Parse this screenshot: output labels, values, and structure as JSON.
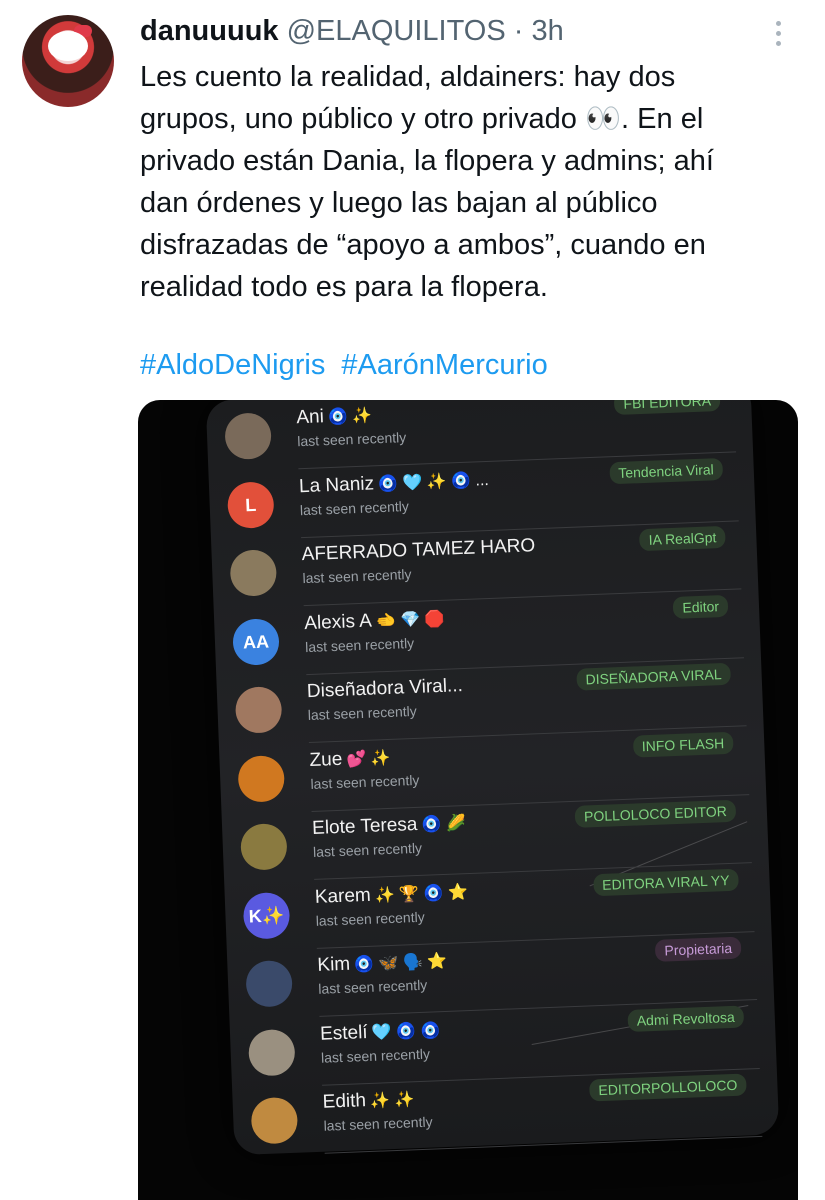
{
  "tweet": {
    "name": "danuuuuk",
    "handle": "@ELAQUILITOS",
    "separator": "·",
    "time": "3h",
    "lines": [
      "Les cuento la realidad, aldainers: hay dos",
      "grupos, uno público y otro privado 👀. En el",
      "privado están Dania, la flopera y admins; ahí",
      "dan órdenes y luego las bajan al público",
      "disfrazadas de “apoyo a ambos”, cuando en",
      "realidad todo es para la flopera."
    ],
    "hashtags": [
      "#AldoDeNigris",
      "#AarónMercurio"
    ]
  },
  "photo": {
    "members": [
      {
        "name": "Ani",
        "emoji": "🧿 ✨",
        "status": "last seen recently",
        "role": "FBI EDITORA",
        "avatar_letter": "",
        "avatar_color": "#7a6a5a"
      },
      {
        "name": "La Naniz",
        "emoji": "🧿 🩵 ✨ 🧿 ...",
        "status": "last seen recently",
        "role": "Tendencia Viral",
        "avatar_letter": "L",
        "avatar_color": "#e2503a"
      },
      {
        "name": "AFERRADO TAMEZ HARO",
        "emoji": "",
        "status": "last seen recently",
        "role": "IA RealGpt",
        "avatar_letter": "",
        "avatar_color": "#8a7a5e"
      },
      {
        "name": "Alexis A",
        "emoji": "🫲 💎 🛑",
        "status": "last seen recently",
        "role": "Editor",
        "avatar_letter": "AA",
        "avatar_color": "#3a82e0"
      },
      {
        "name": "Diseñadora Viral...",
        "emoji": "",
        "status": "last seen recently",
        "role": "DISEÑADORA VIRAL",
        "avatar_letter": "",
        "avatar_color": "#a07860"
      },
      {
        "name": "Zue",
        "emoji": "💕 ✨",
        "status": "last seen recently",
        "role": "INFO FLASH",
        "avatar_letter": "",
        "avatar_color": "#d07820"
      },
      {
        "name": "Elote Teresa",
        "emoji": "🧿 🌽",
        "status": "last seen recently",
        "role": "POLLOLOCO EDITOR",
        "avatar_letter": "",
        "avatar_color": "#8a7a40"
      },
      {
        "name": "Karem",
        "emoji": "✨ 🏆 🧿 ⭐",
        "status": "last seen recently",
        "role": "EDITORA VIRAL YY",
        "avatar_letter": "K✨",
        "avatar_color": "#5a5ae0"
      },
      {
        "name": "Kim",
        "emoji": "🧿 🦋 🗣️ ⭐",
        "status": "last seen recently",
        "role": "Propietaria",
        "avatar_letter": "",
        "avatar_color": "#3a4a6a"
      },
      {
        "name": "Estelí",
        "emoji": "🩵 🧿 🧿",
        "status": "last seen recently",
        "role": "Admi Revoltosa",
        "avatar_letter": "",
        "avatar_color": "#9a9080"
      },
      {
        "name": "Edith",
        "emoji": "✨ ✨",
        "status": "last seen recently",
        "role": "EDITORPOLLOLOCO",
        "avatar_letter": "",
        "avatar_color": "#c08a40"
      }
    ]
  },
  "icons": {
    "more": "more-vertical-icon"
  }
}
